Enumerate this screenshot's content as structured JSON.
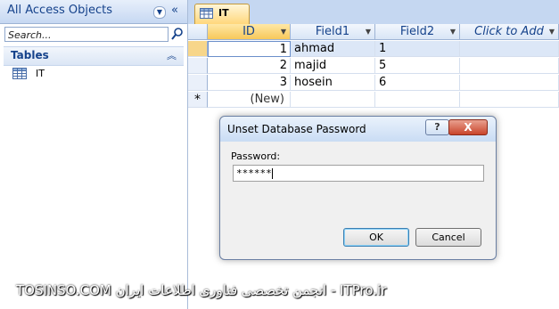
{
  "nav": {
    "title": "All Access Objects",
    "search_placeholder": "Search...",
    "group_title": "Tables",
    "items": [
      {
        "label": "IT"
      }
    ]
  },
  "doc_tab": {
    "label": "IT"
  },
  "datasheet": {
    "columns": [
      "ID",
      "Field1",
      "Field2",
      "Click to Add"
    ],
    "rows": [
      {
        "id": "1",
        "field1": "ahmad",
        "field2": "1"
      },
      {
        "id": "2",
        "field1": "majid",
        "field2": "5"
      },
      {
        "id": "3",
        "field1": "hosein",
        "field2": "6"
      }
    ],
    "new_row_marker": "*",
    "new_row_label": "(New)"
  },
  "dialog": {
    "title": "Unset Database Password",
    "help_label": "?",
    "close_label": "X",
    "password_label": "Password:",
    "password_value": "******",
    "ok_label": "OK",
    "cancel_label": "Cancel"
  },
  "watermark": {
    "text": "TOSINSO.COM انجمن تخصصی فناوری اطلاعات ایران - ITPro.ir"
  },
  "colors": {
    "accent": "#15428b",
    "selected_header": "#f7c85a",
    "close_button": "#c9452b"
  }
}
